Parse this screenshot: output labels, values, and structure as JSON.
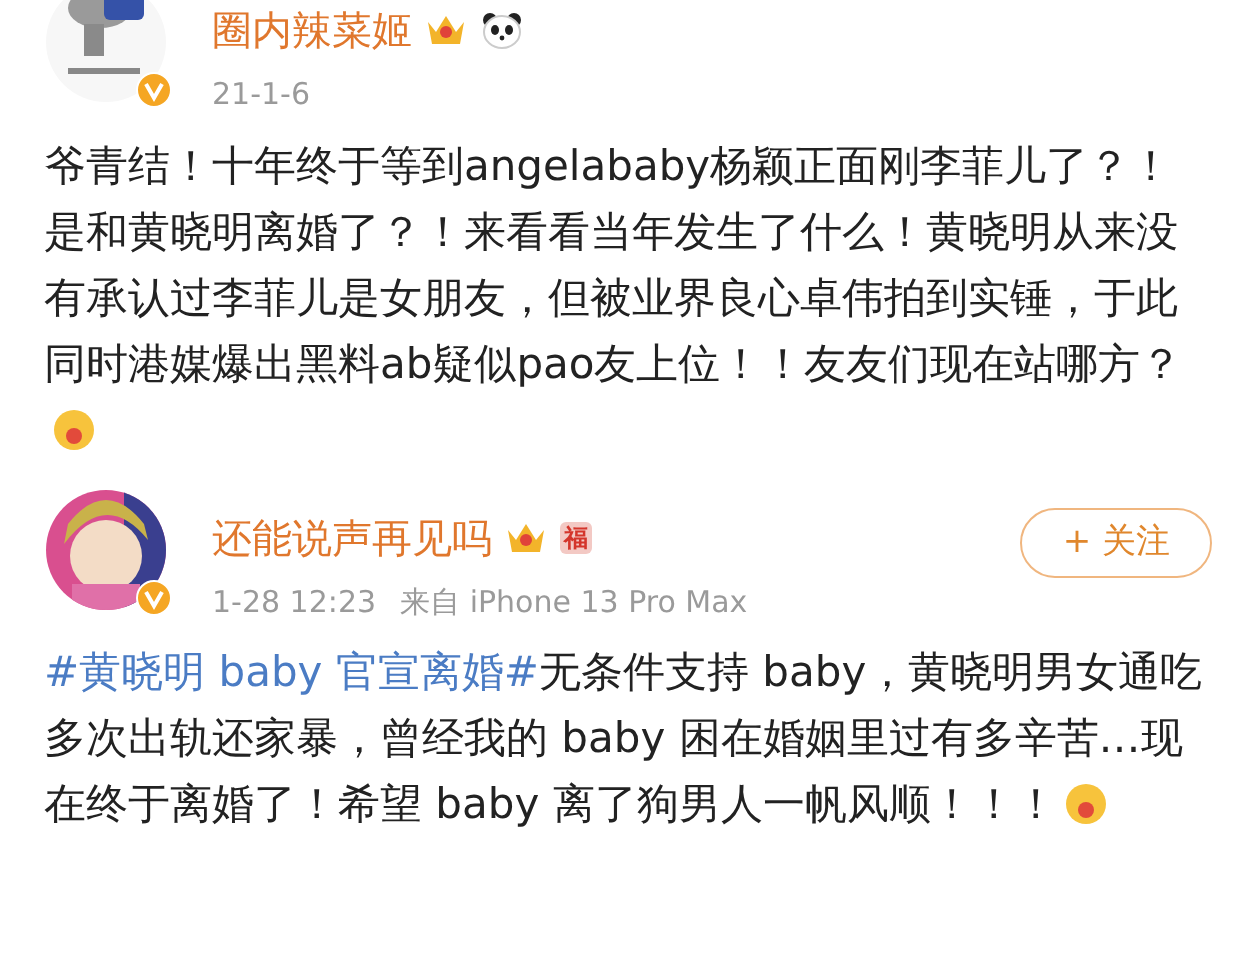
{
  "posts": [
    {
      "author": "圈内辣菜姬",
      "date": "21-1-6",
      "badges": [
        {
          "kind": "crown"
        },
        {
          "kind": "panda"
        }
      ],
      "body": [
        {
          "kind": "text",
          "text": "爷青结！十年终于等到angelababy杨颖正面刚李菲儿了？！是和黄晓明离婚了？！来看看当年发生了什么！黄晓明从来没有承认过李菲儿是女朋友，但被业界良心卓伟拍到实锤，于此同时港媒爆出黑料ab疑似pao友上位！！友友们现在站哪方？"
        },
        {
          "kind": "emoji"
        }
      ]
    },
    {
      "author": "还能说声再见吗",
      "date": "1-28 12:23",
      "source": "来自 iPhone 13 Pro Max",
      "badges": [
        {
          "kind": "crown"
        },
        {
          "kind": "fu",
          "text": "福"
        }
      ],
      "body": [
        {
          "kind": "hashtag",
          "text": "#黄晓明 baby 官宣离婚#"
        },
        {
          "kind": "text",
          "text": "无条件支持 baby，黄晓明男女通吃多次出轨还家暴，曾经我的 baby 困在婚姻里过有多辛苦…现在终于离婚了！希望 baby 离了狗男人一帆风顺！！！"
        },
        {
          "kind": "emoji"
        }
      ],
      "follow": {
        "label": "+ 关注"
      }
    }
  ]
}
